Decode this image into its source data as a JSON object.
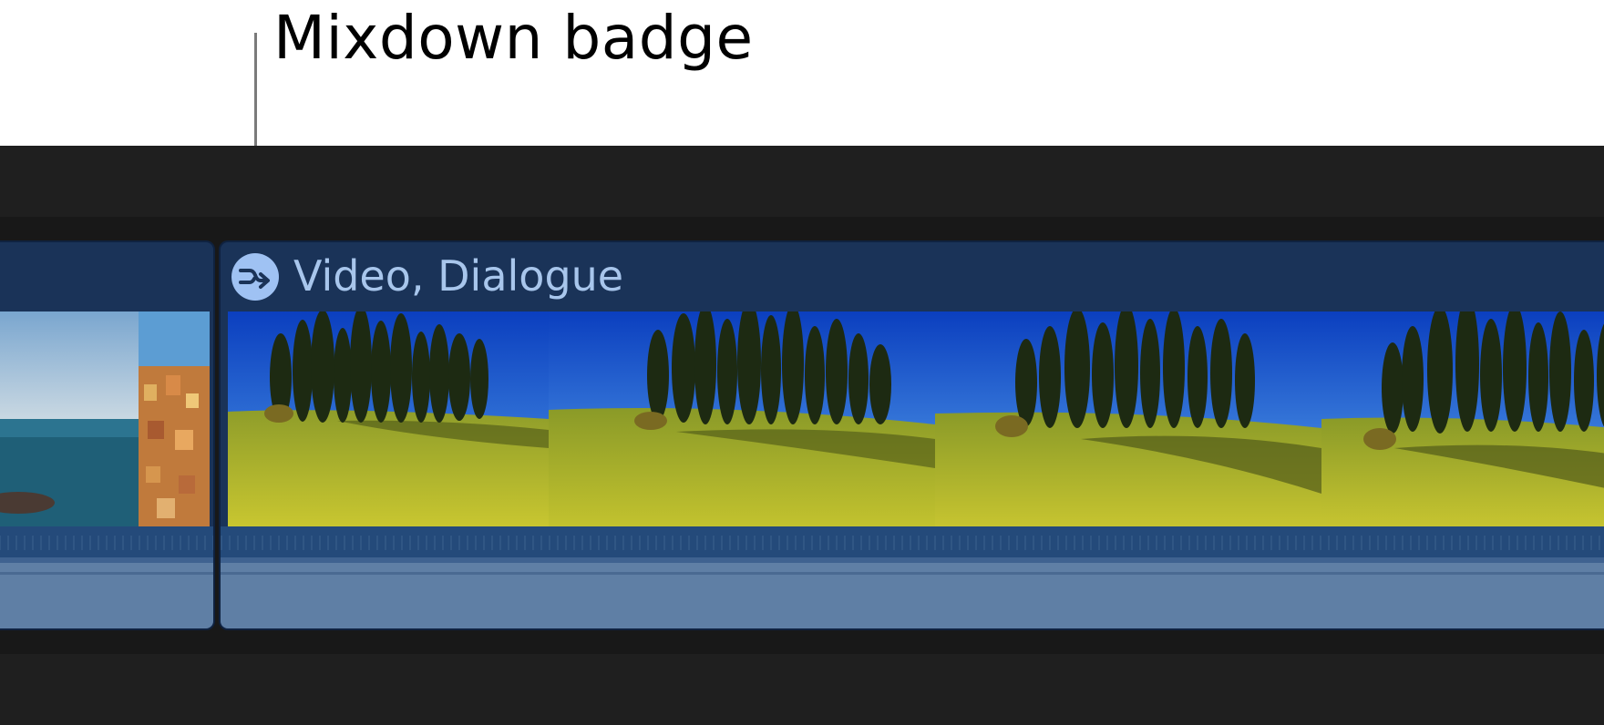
{
  "callout": {
    "label": "Mixdown badge"
  },
  "timeline": {
    "clip": {
      "title": "Video, Dialogue",
      "badge_icon": "mixdown-icon",
      "colors": {
        "header": "#1a3358",
        "badge": "#9fc2f3",
        "title": "#a8c6ec",
        "audio": "#5f7fa5"
      }
    },
    "previous_clip": {
      "thumbnails": [
        "coastal-sea",
        "coastal-village"
      ]
    },
    "thumbnails": [
      "cypress-field-1",
      "cypress-field-2",
      "cypress-field-3",
      "cypress-field-4"
    ]
  }
}
